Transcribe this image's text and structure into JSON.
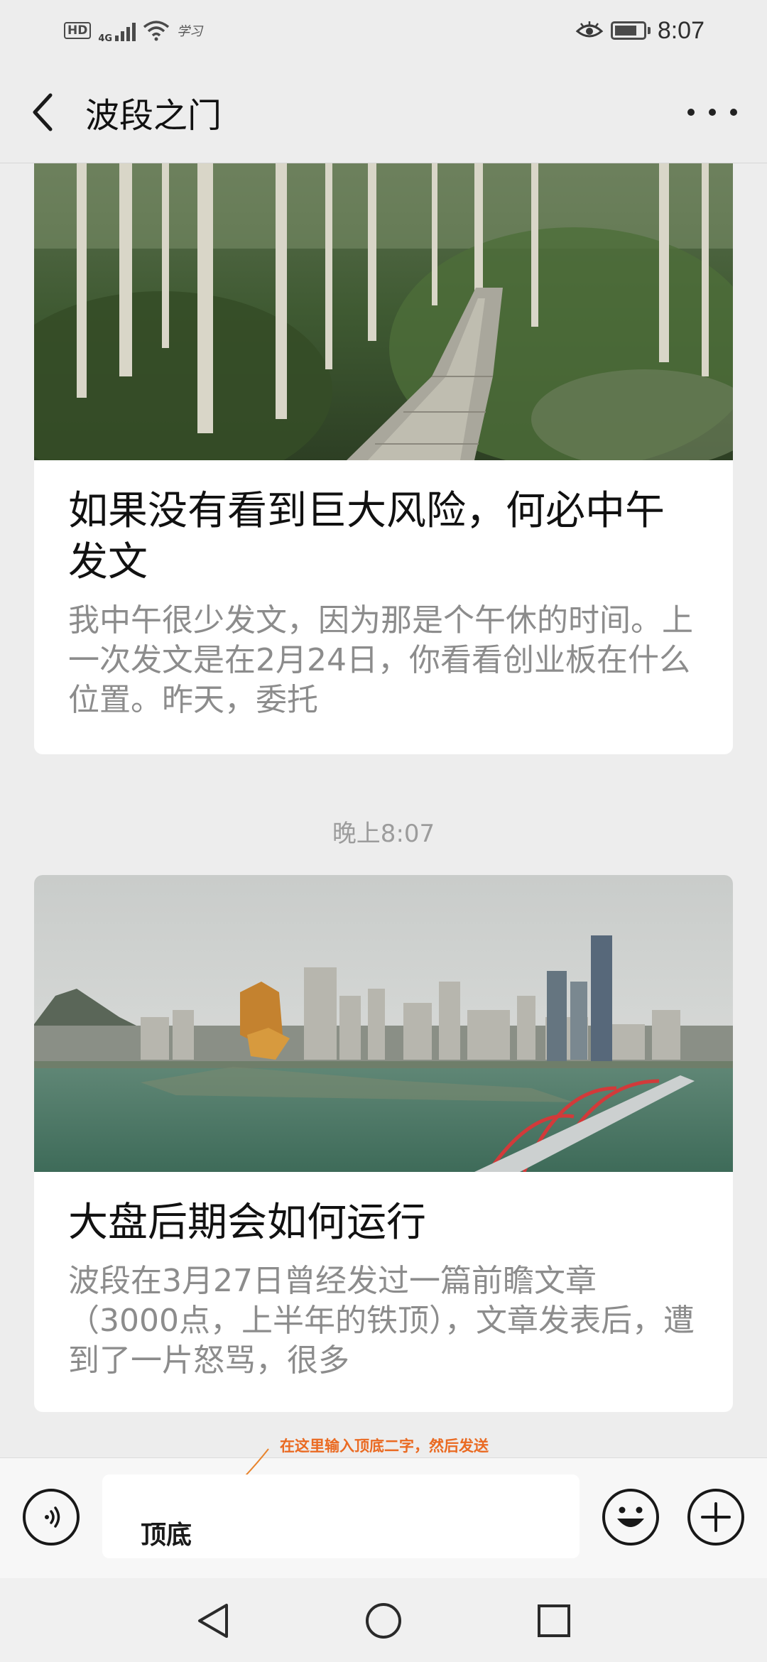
{
  "status_bar": {
    "hd": "HD",
    "network": "4G",
    "carrier_logo": "学习",
    "time": "8:07",
    "battery_level": 0.8,
    "icons": [
      "hd-icon",
      "signal-icon",
      "wifi-icon",
      "eye-comfort-icon",
      "battery-icon"
    ]
  },
  "header": {
    "title": "波段之门",
    "back_icon": "chevron-left-icon",
    "more_icon": "more-dots-icon"
  },
  "articles": [
    {
      "image": "forest-boardwalk-photo",
      "title": "如果没有看到巨大风险，何必中午发文",
      "summary": "我中午很少发文，因为那是个午休的时间。上一次发文是在2月24日，你看看创业板在什么位置。昨天，委托"
    },
    {
      "image": "city-river-skyline-photo",
      "title": "大盘后期会如何运行",
      "summary": "波段在3月27日曾经发过一篇前瞻文章（3000点，上半年的铁顶），文章发表后，遭到了一片怒骂，很多"
    }
  ],
  "timestamp": "晚上8:07",
  "annotation": "在这里输入顶底二字，然后发送",
  "input_bar": {
    "value": "顶底",
    "voice_icon": "voice-icon",
    "emoji_icon": "emoji-icon",
    "plus_icon": "plus-icon"
  },
  "nav_bar": {
    "icons": [
      "nav-back-icon",
      "nav-home-icon",
      "nav-recents-icon"
    ]
  }
}
